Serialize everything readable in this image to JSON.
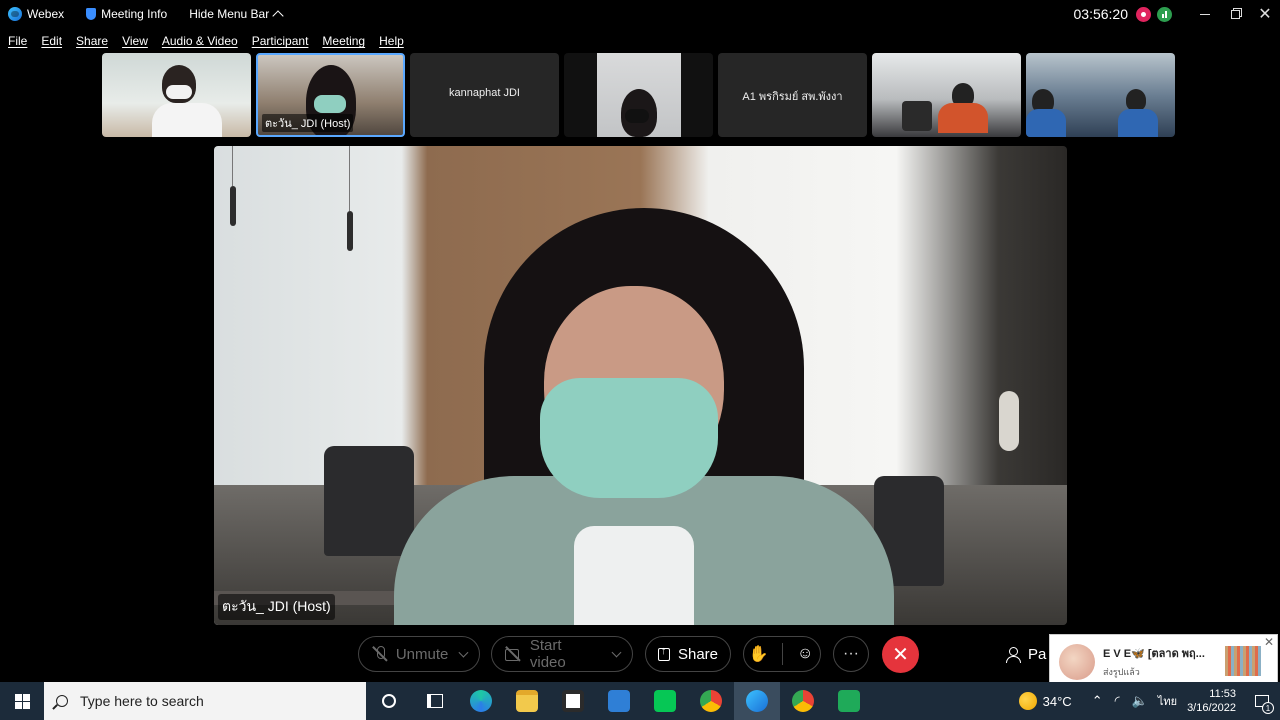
{
  "titlebar": {
    "app_name": "Webex",
    "meeting_info": "Meeting Info",
    "hide_menu": "Hide Menu Bar",
    "timer": "03:56:20"
  },
  "menu": [
    "File",
    "Edit",
    "Share",
    "View",
    "Audio & Video",
    "Participant",
    "Meeting",
    "Help"
  ],
  "thumbnails": [
    {
      "label": "",
      "type": "video"
    },
    {
      "label": "ตะวัน_ JDI (Host)",
      "type": "video",
      "active": true
    },
    {
      "label": "kannaphat JDI",
      "type": "name-only"
    },
    {
      "label": "",
      "type": "video"
    },
    {
      "label": "A1 พรกิรมย์ สพ.พังงา",
      "type": "name-only"
    },
    {
      "label": "",
      "type": "video"
    },
    {
      "label": "",
      "type": "video"
    }
  ],
  "main_video": {
    "speaker_label": "ตะวัน_ JDI (Host)"
  },
  "controls": {
    "unmute": "Unmute",
    "start_video": "Start video",
    "share": "Share",
    "participants_label": "Pa"
  },
  "toast": {
    "title": "E V E🦋 [ตลาด พฤ...",
    "subtitle": "ส่งรูปแล้ว"
  },
  "taskbar": {
    "search_placeholder": "Type here to search",
    "temperature": "34°C",
    "language": "ไทย",
    "time": "11:53",
    "date": "3/16/2022",
    "notification_count": "1"
  },
  "colors": {
    "end_call": "#e5343c",
    "active_border": "#5aa8ff",
    "taskbar": "#1c2b3a"
  }
}
